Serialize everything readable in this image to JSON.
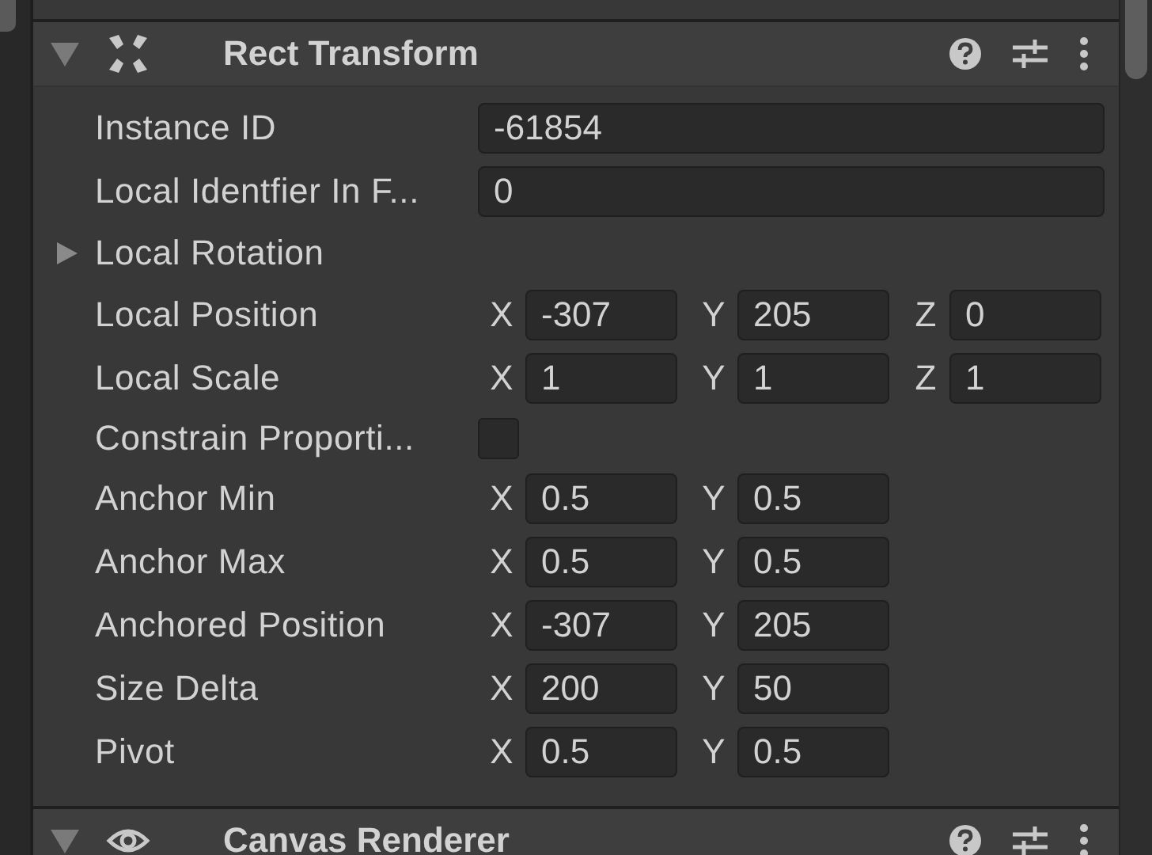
{
  "components": [
    {
      "title": "Rect Transform",
      "expanded": true,
      "kind": "transform",
      "rows": [
        {
          "kind": "text",
          "label": "Instance ID",
          "value": "-61854"
        },
        {
          "kind": "text",
          "label": "Local Identfier In F...",
          "value": "0"
        },
        {
          "kind": "foldout",
          "label": "Local Rotation",
          "expanded": false
        },
        {
          "kind": "vector",
          "label": "Local Position",
          "axes": [
            {
              "axis": "X",
              "value": "-307"
            },
            {
              "axis": "Y",
              "value": "205"
            },
            {
              "axis": "Z",
              "value": "0"
            }
          ]
        },
        {
          "kind": "vector",
          "label": "Local Scale",
          "axes": [
            {
              "axis": "X",
              "value": "1"
            },
            {
              "axis": "Y",
              "value": "1"
            },
            {
              "axis": "Z",
              "value": "1"
            }
          ]
        },
        {
          "kind": "toggle",
          "label": "Constrain Proporti...",
          "checked": false
        },
        {
          "kind": "vector",
          "label": "Anchor Min",
          "axes": [
            {
              "axis": "X",
              "value": "0.5"
            },
            {
              "axis": "Y",
              "value": "0.5"
            }
          ]
        },
        {
          "kind": "vector",
          "label": "Anchor Max",
          "axes": [
            {
              "axis": "X",
              "value": "0.5"
            },
            {
              "axis": "Y",
              "value": "0.5"
            }
          ]
        },
        {
          "kind": "vector",
          "label": "Anchored Position",
          "axes": [
            {
              "axis": "X",
              "value": "-307"
            },
            {
              "axis": "Y",
              "value": "205"
            }
          ]
        },
        {
          "kind": "vector",
          "label": "Size Delta",
          "axes": [
            {
              "axis": "X",
              "value": "200"
            },
            {
              "axis": "Y",
              "value": "50"
            }
          ]
        },
        {
          "kind": "vector",
          "label": "Pivot",
          "axes": [
            {
              "axis": "X",
              "value": "0.5"
            },
            {
              "axis": "Y",
              "value": "0.5"
            }
          ]
        }
      ]
    },
    {
      "title": "Canvas Renderer",
      "expanded": true,
      "kind": "renderer"
    }
  ]
}
